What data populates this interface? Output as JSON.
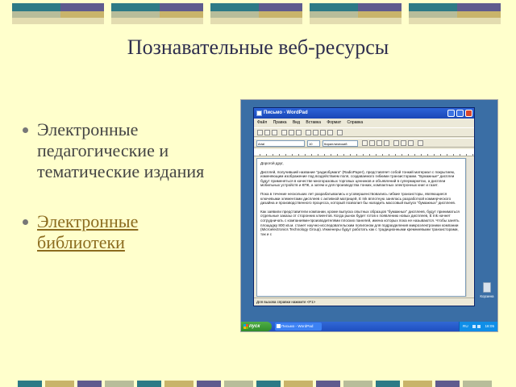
{
  "slide": {
    "title": "Познавательные веб-ресурсы",
    "bullets": [
      {
        "text": "Электронные педагогические и тематические издания",
        "is_link": false
      },
      {
        "text": "Электронные библиотеки",
        "is_link": true
      }
    ]
  },
  "colors": {
    "background": "#ffffcc",
    "title": "#2f2f4f",
    "bullet_text": "#444444",
    "link": "#8b6b1e",
    "bar_teal": "#2d7a86",
    "bar_purple": "#5f5b8e",
    "bar_sage": "#b8bd9a",
    "bar_gold": "#c9b46a",
    "desktop": "#3a6ea5"
  },
  "screenshot": {
    "window_title": "Письмо - WordPad",
    "menu": [
      "Файл",
      "Правка",
      "Вид",
      "Вставка",
      "Формат",
      "Справка"
    ],
    "font_name": "Arial",
    "font_size": "10",
    "script": "Кириллический",
    "document": [
      "Дорогой друг,",
      "Дисплей, получивший название \"радиобумага\" (RadioPaper), представляет собой тонкий материал с покрытием, изменяющим изображение под воздействием поля, создаваемого гибкими транзисторами. \"Бумажные\" дисплеи будут применяться в качестве многоразовых торговых ценников и объявлений в супермаркетах, а дисплеи мобильных устройств и КПК, а затем и для производства тонких, компактных электронных книг и газет.",
      "Пока в течение нескольких лет разрабатывались и усовершенствовались гибкие транзисторы, являющиеся ключевыми элементами дисплеев с активной матрицей, E Ink вплотную занялась разработкой коммерческого дизайна и производственного процесса, который позволил бы наладить массовый выпуск \"бумажных\" дисплеев.",
      "Как заявили представители компании, кроме выпуска опытных образцов \"бумажных\" дисплеев, будут приниматься отдельные заказы от сторонних клиентов. Когда рынок будет готов к появлению новых дисплеев, E Ink начнет сотрудничать с компаниями-производителями плоских панелей, имена которых пока не называются. Чтобы занять площадку 800 кв.м. станет научно-исследовательским полигоном для подразделения микроэлектроники компании (Microelectronics Technology Group). Инженеры будут работать как с традиционными кремниевыми транзисторами, так и с"
    ],
    "status": "Для вызова справки нажмите <F1>",
    "recycle_label": "Корзина",
    "start_label": "пуск",
    "task_label": "Письмо - WordPad",
    "tray_lang": "RU",
    "tray_clock": "18:05"
  }
}
